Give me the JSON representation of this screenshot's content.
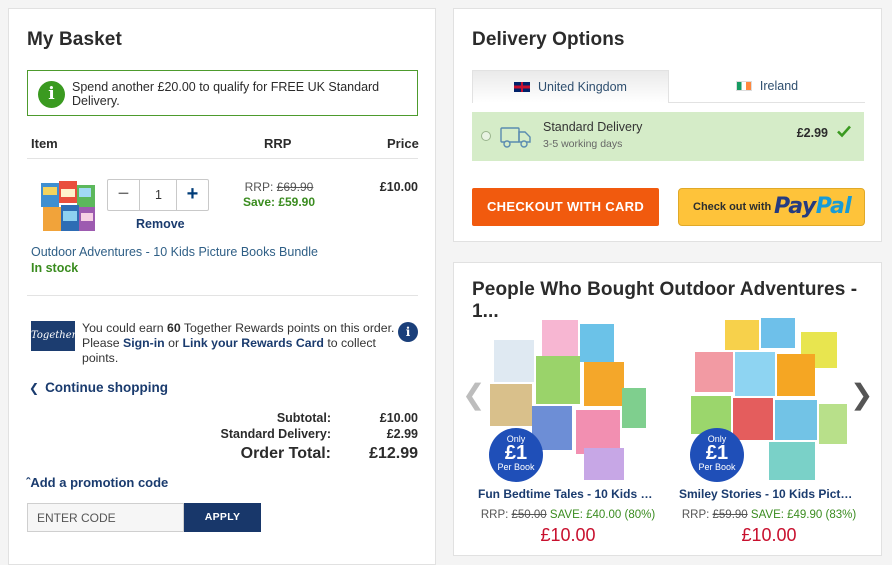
{
  "basket": {
    "title": "My Basket",
    "notice": "Spend another £20.00 to qualify for FREE UK Standard Delivery.",
    "headers": {
      "item": "Item",
      "rrp": "RRP",
      "price": "Price"
    },
    "item": {
      "quantity": "1",
      "minus": "−",
      "plus": "+",
      "remove": "Remove",
      "rrp_label": "RRP:",
      "rrp_value": "£69.90",
      "save": "Save: £59.90",
      "price": "£10.00",
      "name": "Outdoor Adventures - 10 Kids Picture Books Bundle",
      "stock": "In stock"
    },
    "rewards": {
      "logo": "Together",
      "text1": "You could earn",
      "points": "60",
      "text2": "Together Rewards points on this order.",
      "text3": "Please",
      "signin": "Sign-in",
      "or": "or",
      "link_card": "Link your Rewards Card",
      "text4": "to collect points.",
      "info": "i"
    },
    "continue": "Continue shopping",
    "totals": {
      "subtotal_label": "Subtotal:",
      "subtotal": "£10.00",
      "delivery_label": "Standard Delivery:",
      "delivery": "£2.99",
      "order_label": "Order Total:",
      "order": "£12.99"
    },
    "promo": {
      "toggle": "Add a promotion code",
      "placeholder": "ENTER CODE",
      "apply": "APPLY"
    }
  },
  "delivery": {
    "title": "Delivery Options",
    "tabs": [
      {
        "label": "United Kingdom",
        "flag": "uk-flag"
      },
      {
        "label": "Ireland",
        "flag": "ireland-flag"
      }
    ],
    "option": {
      "title": "Standard Delivery",
      "sub": "3-5 working days",
      "price": "£2.99"
    },
    "checkout_card": "CHECKOUT WITH CARD",
    "paypal_prefix": "Check out with",
    "paypal_logo_a": "Pay",
    "paypal_logo_b": "Pal"
  },
  "people": {
    "title": "People Who Bought Outdoor Adventures - 1...",
    "items": [
      {
        "name": "Fun Bedtime Tales - 10 Kids Pi...",
        "rrp_label": "RRP:",
        "rrp": "£50.00",
        "save": "SAVE: £40.00 (80%)",
        "price": "£10.00",
        "badge_top": "Only",
        "badge_mid": "£1",
        "badge_bot": "Per Book"
      },
      {
        "name": "Smiley Stories - 10 Kids Pictur...",
        "rrp_label": "RRP:",
        "rrp": "£59.90",
        "save": "SAVE: £49.90 (83%)",
        "price": "£10.00",
        "badge_top": "Only",
        "badge_mid": "£1",
        "badge_bot": "Per Book"
      }
    ]
  },
  "colors": {
    "brand_navy": "#1a3b6e",
    "checkout_orange": "#f15a0e",
    "paypal_yellow": "#fec33a",
    "success_green": "#3a8c1f",
    "price_red": "#c8102e",
    "delivery_bg": "#d5ecc8"
  }
}
